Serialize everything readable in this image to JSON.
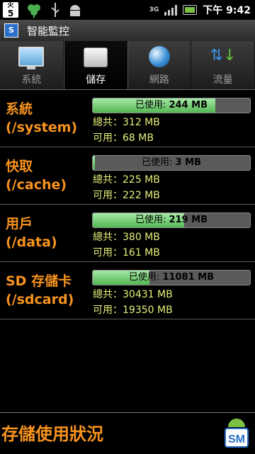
{
  "status_bar": {
    "date_label": "火",
    "date_num": "5",
    "network": "3G",
    "time": "下午 9:42"
  },
  "app": {
    "icon_text": "S",
    "title": "智能監控"
  },
  "tabs": [
    {
      "label": "系統",
      "icon": "monitor-icon",
      "active": false
    },
    {
      "label": "儲存",
      "icon": "drive-icon",
      "active": true
    },
    {
      "label": "網路",
      "icon": "globe-icon",
      "active": false
    },
    {
      "label": "流量",
      "icon": "traffic-arrows-icon",
      "active": false
    }
  ],
  "storage": [
    {
      "name": "系統",
      "path": "(/system)",
      "used_label": "已使用:",
      "used_value": "244 MB",
      "used_fraction": 0.78,
      "total_label": "總共：312 MB",
      "free_label": "可用：68 MB"
    },
    {
      "name": "快取",
      "path": "(/cache)",
      "used_label": "已使用:",
      "used_value": "3 MB",
      "used_fraction": 0.013,
      "total_label": "總共：225 MB",
      "free_label": "可用：222 MB"
    },
    {
      "name": "用戶",
      "path": "(/data)",
      "used_label": "已使用:",
      "used_value": "219 MB",
      "used_fraction": 0.58,
      "total_label": "總共：380 MB",
      "free_label": "可用：161 MB"
    },
    {
      "name": "SD 存儲卡",
      "path": "(/sdcard)",
      "used_label": "已使用:",
      "used_value": "11081 MB",
      "used_fraction": 0.36,
      "total_label": "總共：30431 MB",
      "free_label": "可用：19350 MB"
    }
  ],
  "footer": {
    "title": "存儲使用狀況",
    "logo_text": "SM"
  },
  "colors": {
    "accent": "#f7931e",
    "info_text": "#e6f07a",
    "bar_fill": "#54b754"
  }
}
